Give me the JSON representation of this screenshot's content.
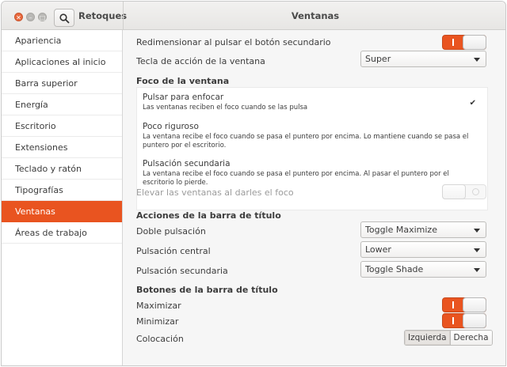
{
  "app": {
    "name": "Retoques",
    "page_title": "Ventanas"
  },
  "sidebar": {
    "items": [
      {
        "label": "Apariencia"
      },
      {
        "label": "Aplicaciones al inicio"
      },
      {
        "label": "Barra superior"
      },
      {
        "label": "Energía"
      },
      {
        "label": "Escritorio"
      },
      {
        "label": "Extensiones"
      },
      {
        "label": "Teclado y ratón"
      },
      {
        "label": "Tipografías"
      },
      {
        "label": "Ventanas"
      },
      {
        "label": "Áreas de trabajo"
      }
    ],
    "selected": "Ventanas"
  },
  "settings": {
    "resize_secondary": {
      "label": "Redimensionar al pulsar el botón secundario",
      "enabled": true
    },
    "action_key": {
      "label": "Tecla de acción de la ventana",
      "value": "Super"
    },
    "focus": {
      "title": "Foco de la ventana",
      "options": [
        {
          "title": "Pulsar para enfocar",
          "desc": "Las ventanas reciben el foco cuando se las pulsa",
          "selected": true
        },
        {
          "title": "Poco riguroso",
          "desc": "La ventana recibe el foco cuando se pasa el puntero por encima. Lo mantiene cuando se pasa el puntero por el escritorio.",
          "selected": false
        },
        {
          "title": "Pulsación secundaria",
          "desc": "La ventana recibe el foco cuando se pasa el puntero por encima. Al pasar el puntero por el escritorio lo pierde.",
          "selected": false
        }
      ]
    },
    "raise_on_focus": {
      "label": "Elevar las ventanas al darles el foco",
      "enabled": false,
      "sensitive": false
    },
    "titlebar_actions": {
      "title": "Acciones de la barra de título",
      "double_click": {
        "label": "Doble pulsación",
        "value": "Toggle Maximize"
      },
      "middle_click": {
        "label": "Pulsación central",
        "value": "Lower"
      },
      "secondary_click": {
        "label": "Pulsación secundaria",
        "value": "Toggle Shade"
      }
    },
    "titlebar_buttons": {
      "title": "Botones de la barra de título",
      "maximize": {
        "label": "Maximizar",
        "enabled": true
      },
      "minimize": {
        "label": "Minimizar",
        "enabled": true
      },
      "placement": {
        "label": "Colocación",
        "options": [
          "Izquierda",
          "Derecha"
        ],
        "selected": "Izquierda"
      }
    }
  },
  "colors": {
    "accent": "#e95420",
    "close_button": "#e9693e"
  },
  "icons": {
    "search": "search-icon",
    "check": "check-icon",
    "dropdown": "chevron-down-icon"
  }
}
